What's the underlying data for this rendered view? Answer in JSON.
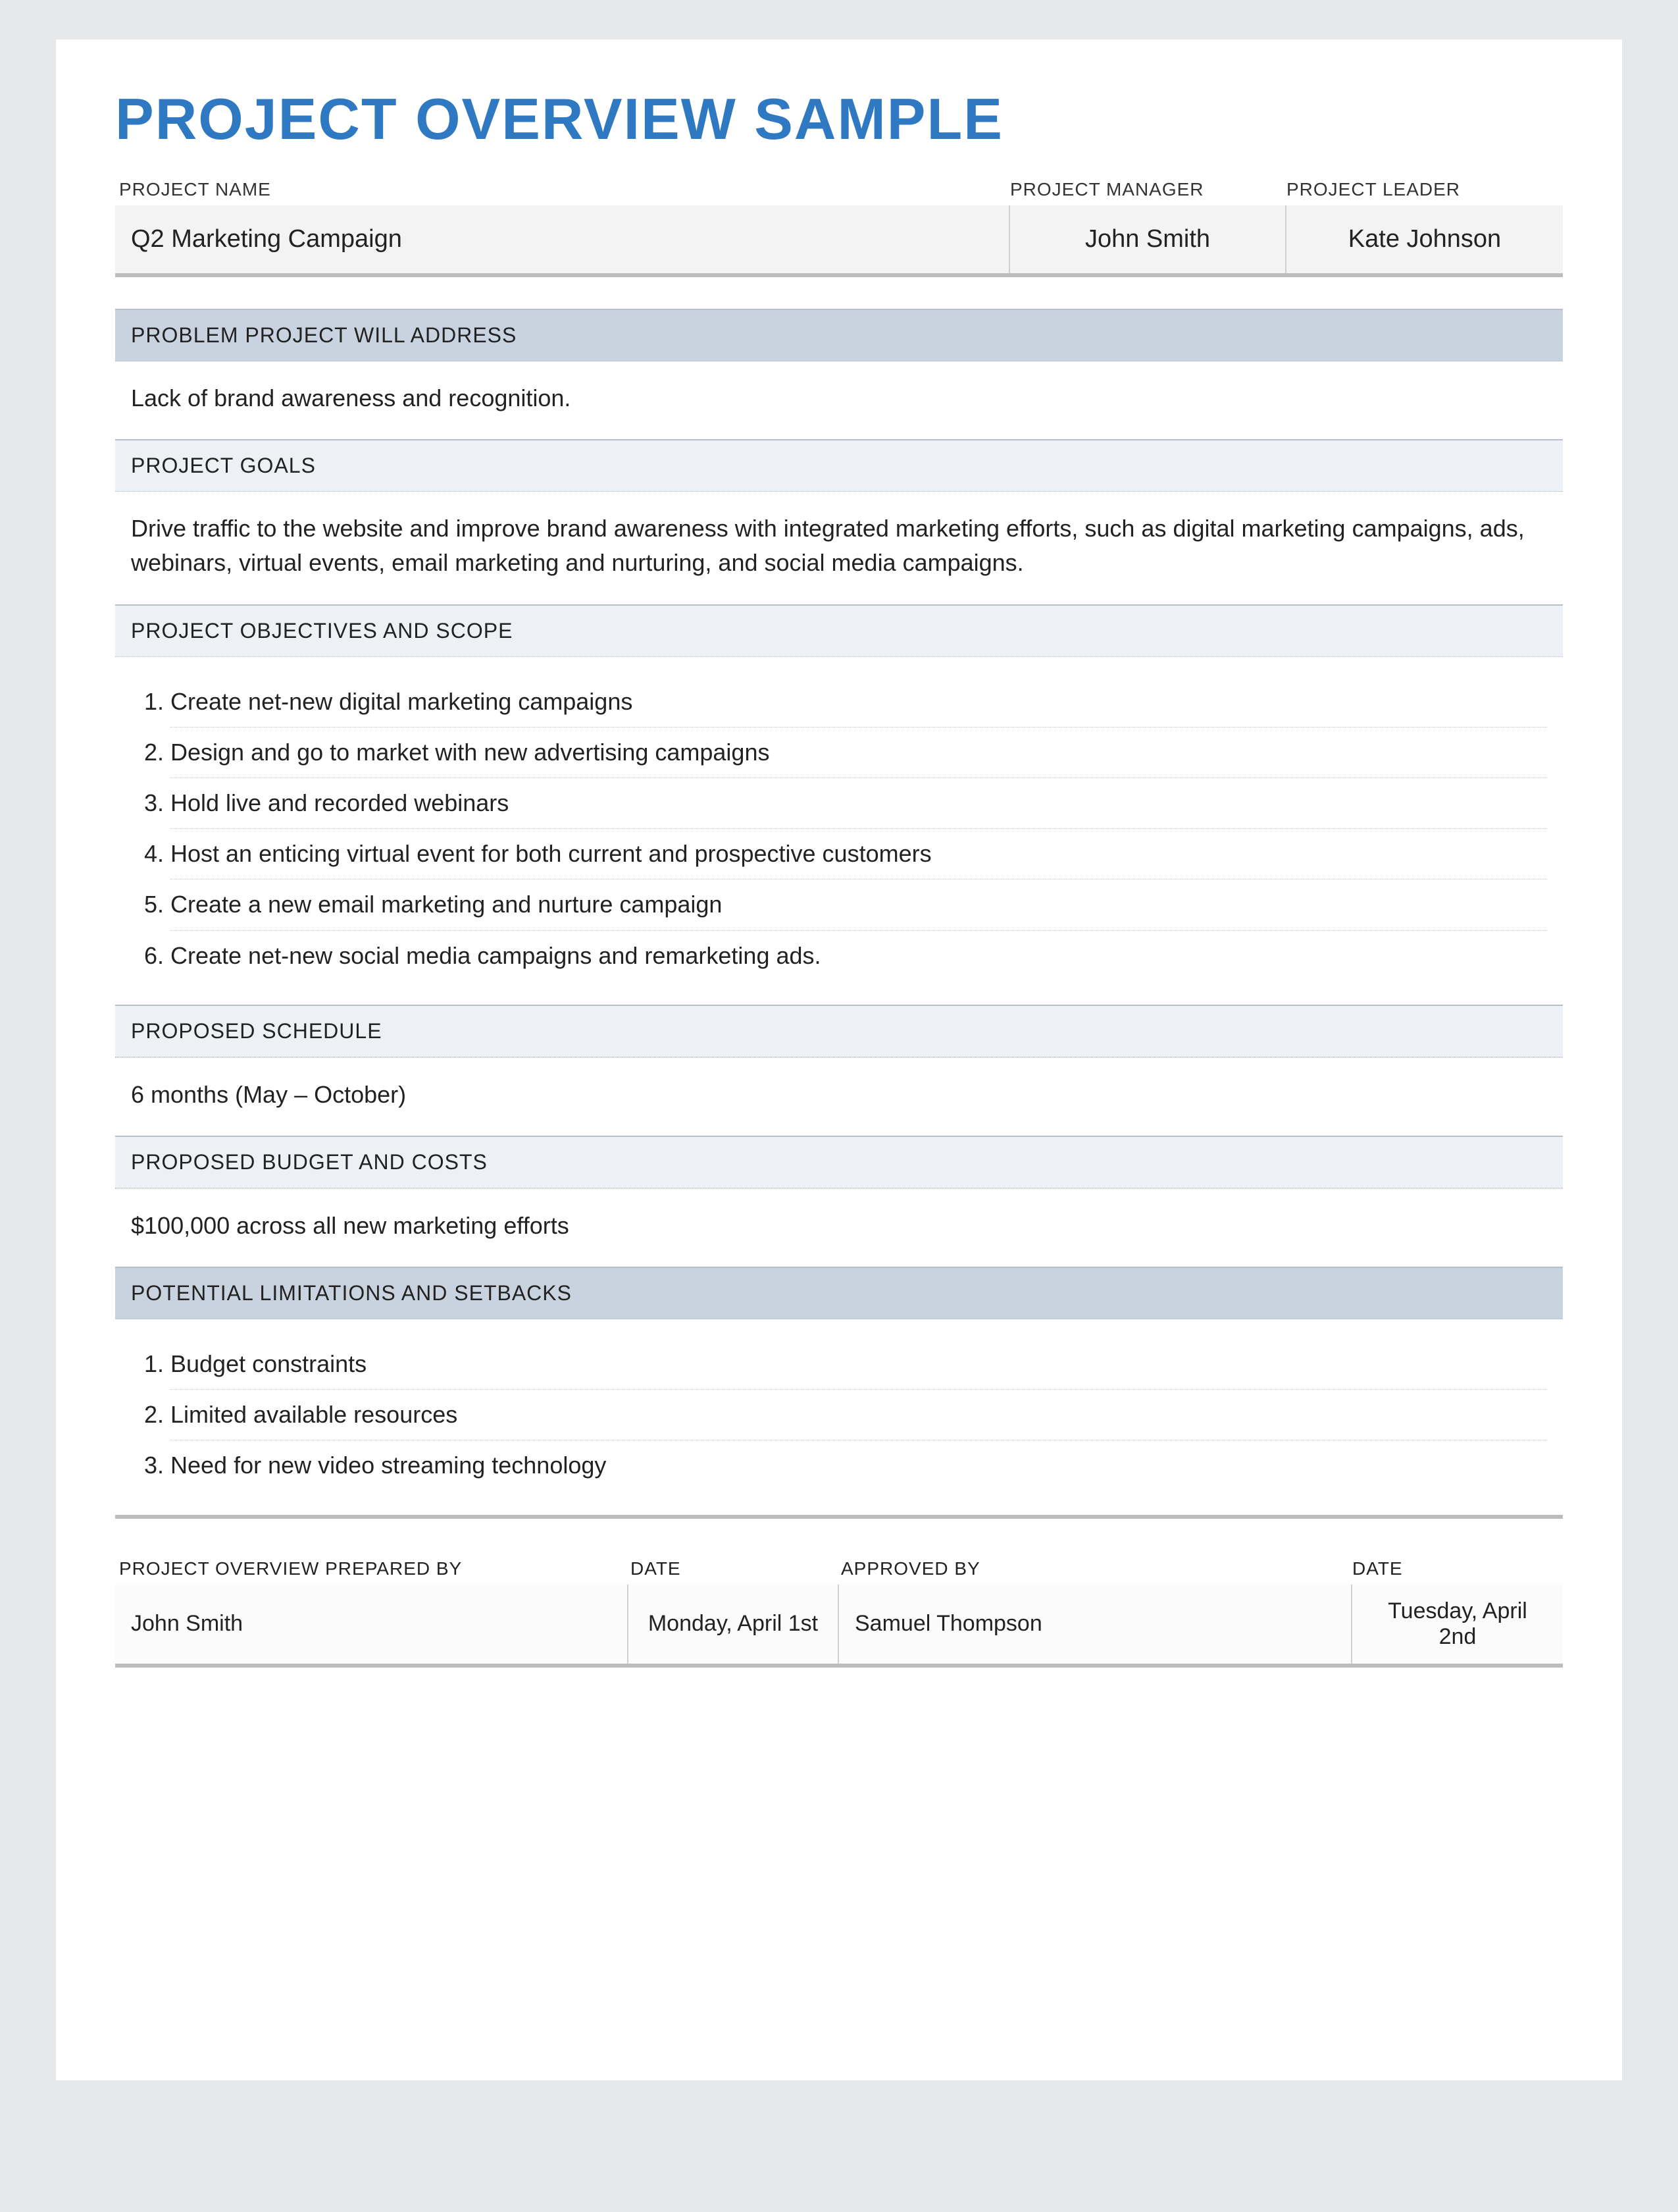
{
  "title": "PROJECT OVERVIEW SAMPLE",
  "meta": {
    "labels": {
      "project_name": "PROJECT NAME",
      "project_manager": "PROJECT MANAGER",
      "project_leader": "PROJECT LEADER"
    },
    "project_name": "Q2 Marketing Campaign",
    "project_manager": "John Smith",
    "project_leader": "Kate Johnson"
  },
  "sections": {
    "problem": {
      "label": "PROBLEM PROJECT WILL ADDRESS",
      "text": "Lack of brand awareness and recognition."
    },
    "goals": {
      "label": "PROJECT GOALS",
      "text": "Drive traffic to the website and improve brand awareness with integrated marketing efforts, such as digital marketing campaigns, ads, webinars, virtual events, email marketing and nurturing, and social media campaigns."
    },
    "objectives": {
      "label": "PROJECT OBJECTIVES AND SCOPE",
      "items": [
        "Create net-new digital marketing campaigns",
        "Design and go to market with new advertising campaigns",
        "Hold live and recorded webinars",
        "Host an enticing virtual event for both current and prospective customers",
        "Create a new email marketing and nurture campaign",
        "Create net-new social media campaigns and remarketing ads."
      ]
    },
    "schedule": {
      "label": "PROPOSED SCHEDULE",
      "text": "6 months (May – October)"
    },
    "budget": {
      "label": "PROPOSED BUDGET AND COSTS",
      "text": "$100,000 across all new marketing efforts"
    },
    "limitations": {
      "label": "POTENTIAL LIMITATIONS AND SETBACKS",
      "items": [
        "Budget constraints",
        "Limited available resources",
        "Need for new video streaming technology"
      ]
    }
  },
  "footer": {
    "labels": {
      "prepared_by": "PROJECT OVERVIEW PREPARED BY",
      "date1": "DATE",
      "approved_by": "APPROVED BY",
      "date2": "DATE"
    },
    "prepared_by": "John Smith",
    "date1": "Monday, April 1st",
    "approved_by": "Samuel Thompson",
    "date2": "Tuesday, April 2nd"
  }
}
